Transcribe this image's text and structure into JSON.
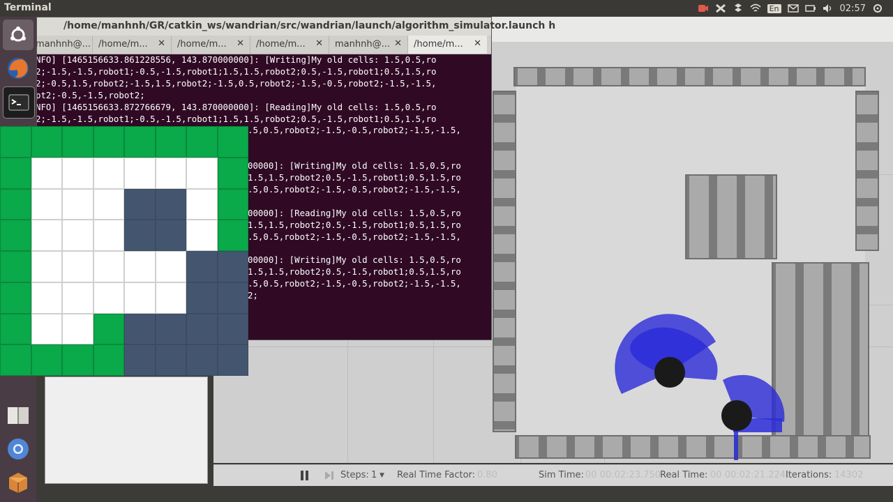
{
  "top_panel": {
    "app_title": "Terminal",
    "clock": "02:57",
    "keyboard_layout": "En"
  },
  "terminal": {
    "window_title": "/home/manhnh/GR/catkin_ws/wandrian/src/wandrian/launch/algorithm_simulator.launch h",
    "tabs": [
      {
        "label": "manhnh@..."
      },
      {
        "label": "/home/m..."
      },
      {
        "label": "/home/m..."
      },
      {
        "label": "/home/m..."
      },
      {
        "label": "manhnh@..."
      },
      {
        "label": "/home/m..."
      }
    ],
    "lines": [
      "NFO] [1465156633.861228556, 143.870000000]: [Writing]My old cells: 1.5,0.5,ro",
      "2;-1.5,-1.5,robot1;-0.5,-1.5,robot1;1.5,1.5,robot2;0.5,-1.5,robot1;0.5,1.5,ro",
      "2;-0.5,1.5,robot2;-1.5,1.5,robot2;-1.5,0.5,robot2;-1.5,-0.5,robot2;-1.5,-1.5,",
      "pt2;-0.5,-1.5,robot2;",
      "NFO] [1465156633.872766679, 143.870000000]: [Reading]My old cells: 1.5,0.5,ro",
      "2;-1.5,-1.5,robot1;-0.5,-1.5,robot1;1.5,1.5,robot2;0.5,-1.5,robot1;0.5,1.5,ro",
      ".5,0.5,robot2;-1.5,-0.5,robot2;-1.5,-1.5,",
      "",
      "",
      "00000]: [Writing]My old cells: 1.5,0.5,ro",
      "1.5,1.5,robot2;0.5,-1.5,robot1;0.5,1.5,ro",
      ".5,0.5,robot2;-1.5,-0.5,robot2;-1.5,-1.5,",
      "",
      "00000]: [Reading]My old cells: 1.5,0.5,ro",
      "1.5,1.5,robot2;0.5,-1.5,robot1;0.5,1.5,ro",
      ".5,0.5,robot2;-1.5,-0.5,robot2;-1.5,-1.5,",
      "",
      "00000]: [Writing]My old cells: 1.5,0.5,ro",
      "1.5,1.5,robot2;0.5,-1.5,robot1;0.5,1.5,ro",
      ".5,0.5,robot2;-1.5,-0.5,robot2;-1.5,-1.5,",
      "2;"
    ]
  },
  "map": {
    "legend_colors": {
      "g": "#0aa94a",
      "w": "#ffffff",
      "d": "#44566f"
    },
    "rows": [
      [
        "g",
        "g",
        "g",
        "g",
        "g",
        "g",
        "g",
        "g"
      ],
      [
        "g",
        "w",
        "w",
        "w",
        "w",
        "w",
        "w",
        "g"
      ],
      [
        "g",
        "w",
        "w",
        "w",
        "d",
        "d",
        "w",
        "g"
      ],
      [
        "g",
        "w",
        "w",
        "w",
        "d",
        "d",
        "w",
        "g"
      ],
      [
        "g",
        "w",
        "w",
        "w",
        "w",
        "w",
        "d",
        "d"
      ],
      [
        "g",
        "w",
        "w",
        "w",
        "w",
        "w",
        "d",
        "d"
      ],
      [
        "g",
        "w",
        "w",
        "g",
        "d",
        "d",
        "d",
        "d"
      ],
      [
        "g",
        "g",
        "g",
        "g",
        "d",
        "d",
        "d",
        "d"
      ]
    ]
  },
  "gazebo": {
    "steps_label": "Steps:",
    "steps_value": "1",
    "rtf_label": "Real Time Factor:",
    "rtf_value": "0.80",
    "sim_time_label": "Sim Time:",
    "sim_time_value": "00 00:02:23.750",
    "real_time_label": "Real Time:",
    "real_time_value": "00 00:02:21.224",
    "iterations_label": "Iterations:",
    "iterations_value": "14302"
  }
}
